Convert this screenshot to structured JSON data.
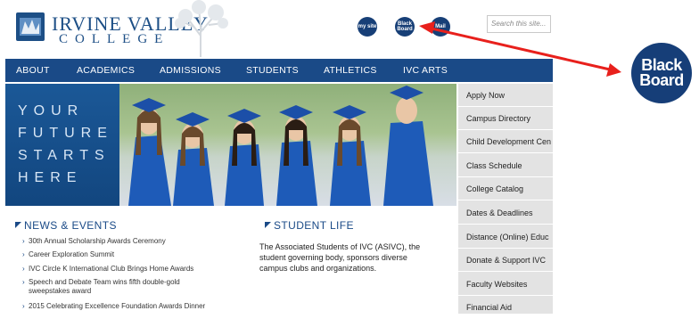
{
  "logo": {
    "line1": "IRVINE VALLEY",
    "line2": "COLLEGE"
  },
  "header": {
    "mysite_label": "my site",
    "blackboard_label": "Black Board",
    "mail_label": "Mail",
    "search_placeholder": "Search this site..."
  },
  "nav": {
    "items": [
      "ABOUT",
      "ACADEMICS",
      "ADMISSIONS",
      "STUDENTS",
      "ATHLETICS",
      "IVC ARTS"
    ]
  },
  "hero": {
    "words": [
      "YOUR",
      "FUTURE",
      "STARTS",
      "HERE"
    ]
  },
  "sidebar": {
    "items": [
      "Apply Now",
      "Campus Directory",
      "Child Development Cen",
      "Class Schedule",
      "College Catalog",
      "Dates & Deadlines",
      "Distance (Online) Educ",
      "Donate & Support IVC",
      "Faculty Websites",
      "Financial Aid"
    ]
  },
  "news": {
    "title": "NEWS & EVENTS",
    "items": [
      "30th Annual Scholarship Awards Ceremony",
      "Career Exploration Summit",
      "IVC Circle K International Club Brings Home Awards",
      "Speech and Debate Team wins fifth double-gold sweepstakes award",
      "2015 Celebrating Excellence Foundation Awards Dinner"
    ]
  },
  "student_life": {
    "title": "STUDENT LIFE",
    "body": "The Associated Students of IVC (ASIVC), the student governing body, sponsors diverse campus clubs and organizations."
  },
  "callout": {
    "label": "Black Board"
  },
  "colors": {
    "brand_blue": "#1a4a87",
    "button_blue": "#173f77",
    "arrow_red": "#e8201c",
    "sidebar_gray": "#e3e3e3"
  }
}
